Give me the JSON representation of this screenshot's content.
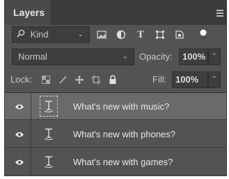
{
  "panel": {
    "tab": "Layers"
  },
  "filter": {
    "kind_label": "Kind"
  },
  "blend": {
    "mode": "Normal",
    "opacity_label": "Opacity:",
    "opacity_value": "100%"
  },
  "lock": {
    "label": "Lock:",
    "fill_label": "Fill:",
    "fill_value": "100%"
  },
  "layers": [
    {
      "name": "What's new with music?",
      "selected": true
    },
    {
      "name": "What's new with phones?",
      "selected": false
    },
    {
      "name": "What's new with games?",
      "selected": false
    }
  ]
}
